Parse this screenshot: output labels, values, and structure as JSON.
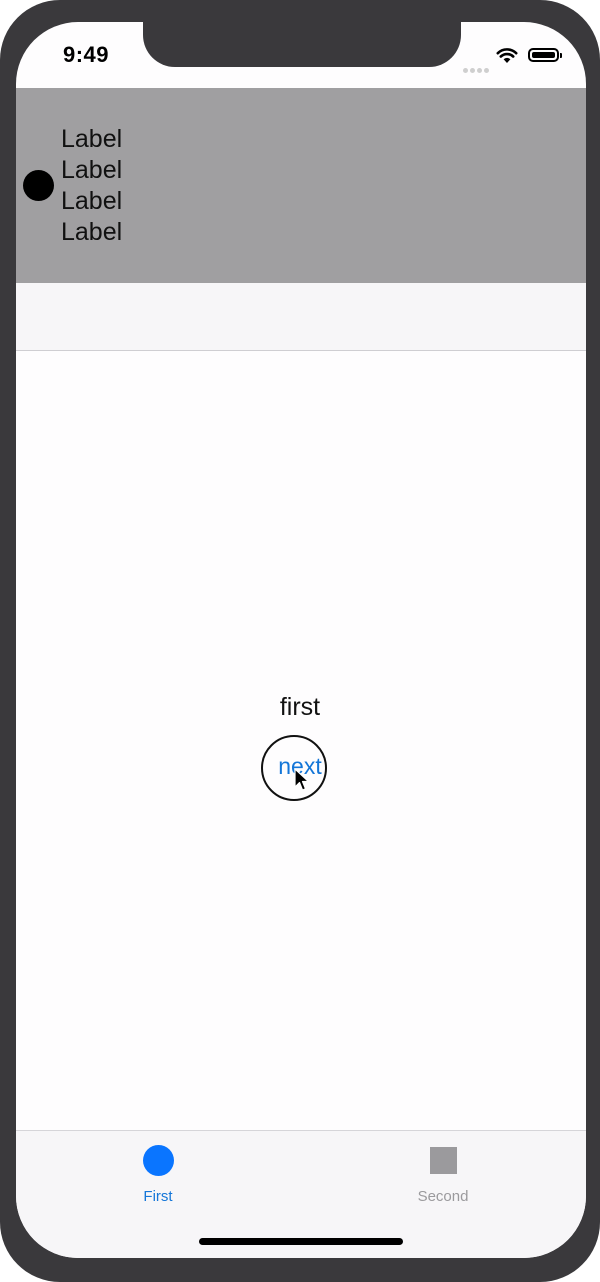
{
  "status_bar": {
    "time": "9:49"
  },
  "header": {
    "labels": [
      "Label",
      "Label",
      "Label",
      "Label"
    ]
  },
  "main": {
    "title": "first",
    "next_button_label": "next"
  },
  "tab_bar": {
    "items": [
      {
        "label": "First",
        "icon": "circle-icon",
        "selected": true
      },
      {
        "label": "Second",
        "icon": "square-icon",
        "selected": false
      }
    ]
  },
  "colors": {
    "accent": "#1476d8",
    "tab_selected_icon": "#0a75ff",
    "tab_unselected": "#9b9a9d",
    "header_background": "#a09fa1",
    "device_frame": "#3a393c"
  }
}
